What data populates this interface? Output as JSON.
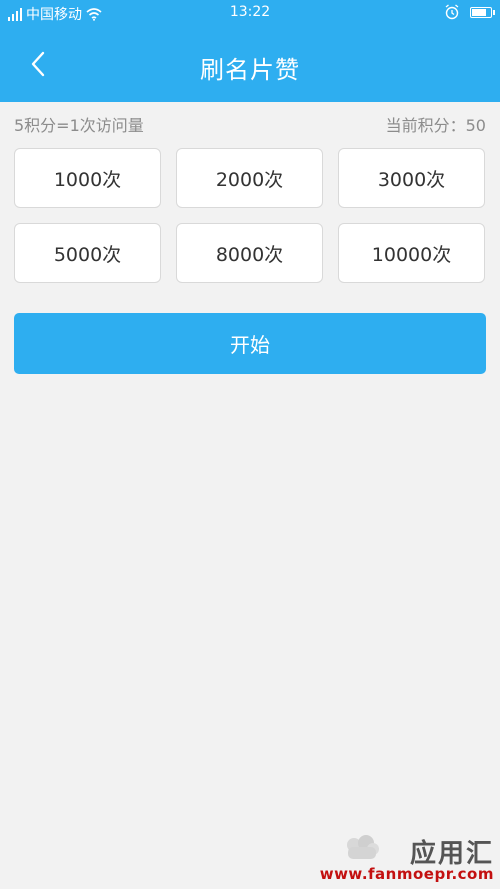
{
  "status_bar": {
    "carrier": "中国移动",
    "time": "13:22",
    "battery_level": 0.85,
    "icons": [
      "signal-icon",
      "wifi-icon",
      "alarm-icon",
      "battery-icon"
    ]
  },
  "nav": {
    "title": "刷名片赞",
    "back_icon": "chevron-left-icon"
  },
  "info": {
    "rate": "5积分=1次访问量",
    "points": "当前积分：50"
  },
  "options": [
    {
      "label": "1000次"
    },
    {
      "label": "2000次"
    },
    {
      "label": "3000次"
    },
    {
      "label": "5000次"
    },
    {
      "label": "8000次"
    },
    {
      "label": "10000次"
    }
  ],
  "start_button": {
    "label": "开始"
  },
  "watermark": {
    "brand": "应用汇",
    "url": "www.fanmoepr.com"
  },
  "colors": {
    "primary": "#2eaef0",
    "background": "#f2f2f2",
    "card": "#ffffff",
    "text_dark": "#333333",
    "text_muted": "#8c8c8c"
  }
}
